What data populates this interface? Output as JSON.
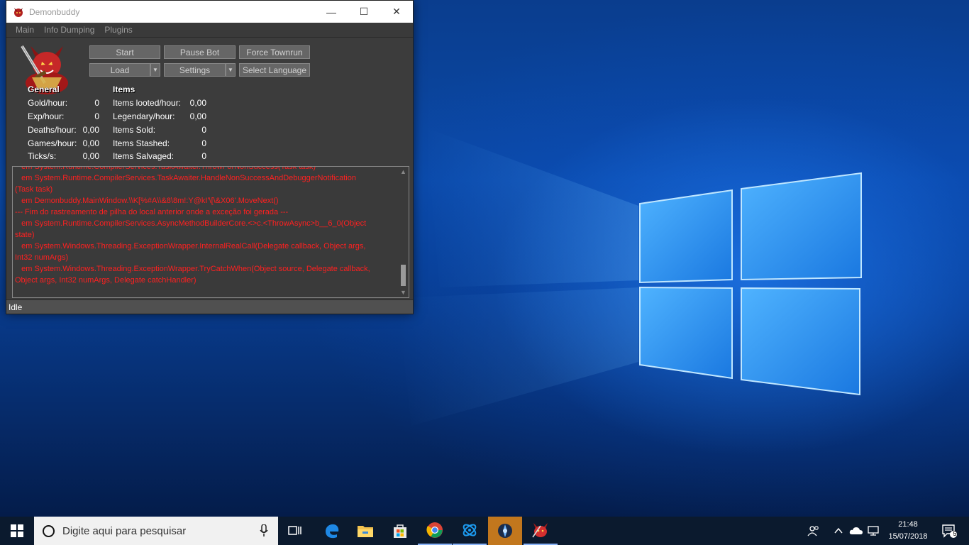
{
  "window": {
    "title": "Demonbuddy",
    "controls": {
      "minimize": "—",
      "maximize": "☐",
      "close": "✕"
    }
  },
  "menu": [
    "Main",
    "Info Dumping",
    "Plugins"
  ],
  "buttons": {
    "start": "Start",
    "pause_bot": "Pause Bot",
    "force_townrun": "Force Townrun",
    "load": "Load",
    "settings": "Settings",
    "select_language": "Select Language",
    "dropdown_arrow": "▼"
  },
  "stats": {
    "general_heading": "General",
    "items_heading": "Items",
    "general": [
      {
        "label": "Gold/hour:",
        "value": "0"
      },
      {
        "label": "Exp/hour:",
        "value": "0"
      },
      {
        "label": "Deaths/hour:",
        "value": "0,00"
      },
      {
        "label": "Games/hour:",
        "value": "0,00"
      },
      {
        "label": "Ticks/s:",
        "value": "0,00"
      }
    ],
    "items": [
      {
        "label": "Items looted/hour:",
        "value": "0,00"
      },
      {
        "label": "Legendary/hour:",
        "value": "0,00"
      },
      {
        "label": "Items Sold:",
        "value": "0"
      },
      {
        "label": "Items Stashed:",
        "value": "0"
      },
      {
        "label": "Items Salvaged:",
        "value": "0"
      }
    ]
  },
  "log": {
    "text": "   em System.Runtime.CompilerServices.TaskAwaiter.ThrowForNonSuccess(Task task)\n   em System.Runtime.CompilerServices.TaskAwaiter.HandleNonSuccessAndDebuggerNotification\n(Task task)\n   em Demonbuddy.MainWindow.\\\\K[%#A\\\\&8\\8m!:Y@kI'\\[\\&X06'.MoveNext()\n--- Fim do rastreamento de pilha do local anterior onde a exceção foi gerada ---\n   em System.Runtime.CompilerServices.AsyncMethodBuilderCore.<>c.<ThrowAsync>b__6_0(Object\nstate)\n   em System.Windows.Threading.ExceptionWrapper.InternalRealCall(Delegate callback, Object args,\nInt32 numArgs)\n   em System.Windows.Threading.ExceptionWrapper.TryCatchWhen(Object source, Delegate callback,\nObject args, Int32 numArgs, Delegate catchHandler)",
    "scroll_up": "▲",
    "scroll_down": "▼"
  },
  "status": "Idle",
  "taskbar": {
    "search_placeholder": "Digite aqui para pesquisar",
    "apps": [
      "task-view-icon",
      "edge-icon",
      "file-explorer-icon",
      "store-icon",
      "chrome-icon",
      "battlenet-icon",
      "diablo-icon",
      "demonbuddy-icon"
    ],
    "tray": {
      "time": "21:48",
      "date": "15/07/2018",
      "notification_count": "5"
    }
  },
  "colors": {
    "log_text": "#ff2020",
    "window_bg": "#3c3c3c",
    "taskbar_bg": "#0b1a2e",
    "highlight_app": "#c2771d"
  }
}
